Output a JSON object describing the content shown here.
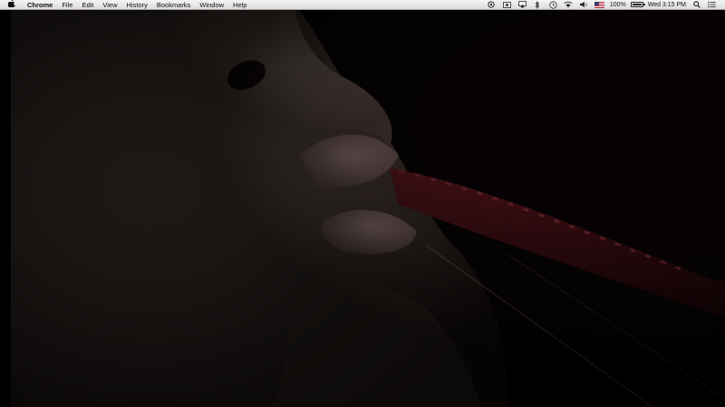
{
  "menubar": {
    "apple_icon": "apple-logo-icon",
    "app_name": "Chrome",
    "menus": [
      "File",
      "Edit",
      "View",
      "History",
      "Bookmarks",
      "Window",
      "Help"
    ],
    "status_icons": [
      "vpn-icon",
      "screen-record-icon",
      "airplay-icon",
      "bluetooth-icon",
      "time-machine-icon",
      "wifi-icon",
      "volume-icon"
    ],
    "input_source": "us-flag-icon",
    "battery_text": "100%",
    "clock": "Wed 3:15 PM",
    "search_icon": "spotlight-search-icon",
    "list_icon": "notification-center-icon"
  },
  "video": {
    "description_icon": "video-frame"
  }
}
